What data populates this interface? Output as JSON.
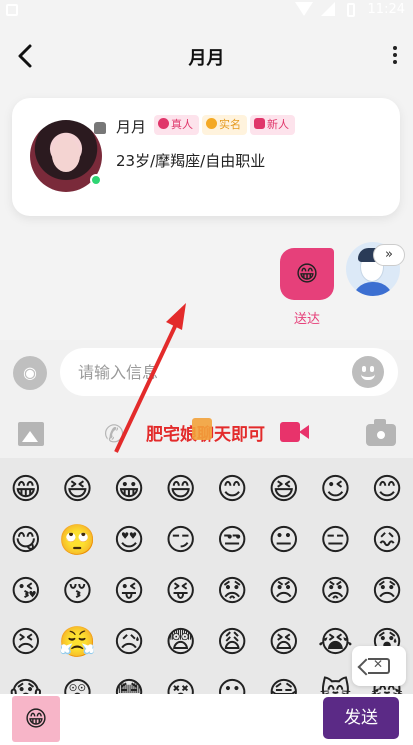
{
  "status_bar": {
    "time": "11:24"
  },
  "header": {
    "title": "月月"
  },
  "profile": {
    "name": "月月",
    "badges": [
      "真人",
      "实名",
      "新人"
    ],
    "info": "23岁/摩羯座/自由职业"
  },
  "chat": {
    "message_emoji": "😁",
    "message_status": "送达",
    "expand_label": "»"
  },
  "input": {
    "placeholder": "请输入信息"
  },
  "annotation": {
    "text": "肥宅娘聊天即可"
  },
  "emoji_grid": [
    "😁",
    "😆",
    "😀",
    "😄",
    "😊",
    "😆",
    "😉",
    "😊",
    "😋",
    "🙄",
    "😍",
    "😏",
    "😒",
    "😐",
    "😑",
    "😖",
    "😘",
    "😚",
    "😜",
    "😝",
    "😟",
    "😠",
    "😡",
    "😞",
    "😣",
    "😤",
    "😥",
    "😨",
    "😩",
    "😫",
    "😭",
    "😰",
    "😱",
    "😲",
    "😳",
    "😵",
    "😶",
    "😷",
    "😸",
    "😹"
  ],
  "bottom": {
    "fav_emoji": "😁",
    "send_label": "发送"
  },
  "colors": {
    "accent_pink": "#e6407a",
    "send_purple": "#5b2a86",
    "annotation_red": "#e32b2b"
  }
}
